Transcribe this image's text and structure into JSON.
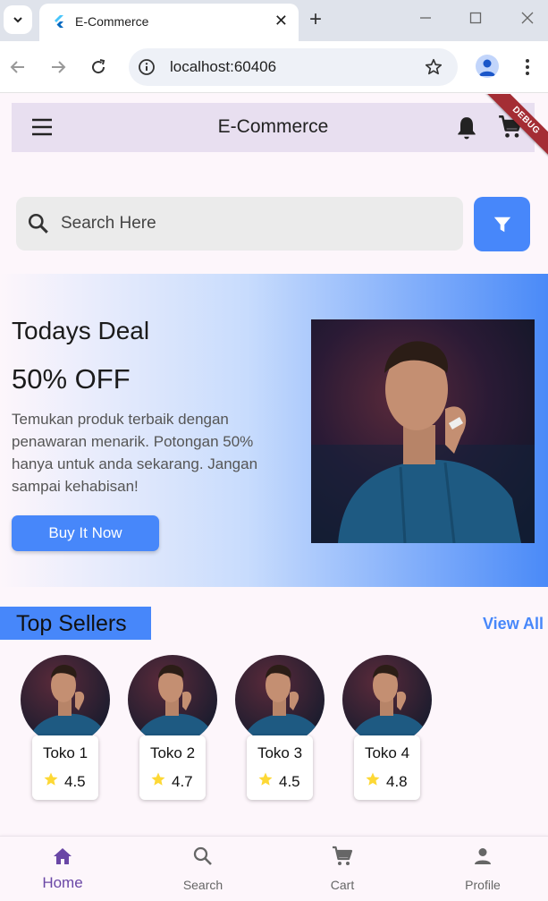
{
  "browser": {
    "tab_title": "E-Commerce",
    "url": "localhost:60406"
  },
  "app": {
    "title": "E-Commerce",
    "debug_label": "DEBUG",
    "search": {
      "placeholder": "Search Here"
    },
    "deal": {
      "title": "Todays Deal",
      "discount": "50% OFF",
      "description": "Temukan produk terbaik dengan penawaran menarik. Potongan 50% hanya untuk anda sekarang. Jangan sampai kehabisan!",
      "button": "Buy It Now"
    },
    "top_sellers": {
      "title": "Top Sellers",
      "view_all": "View All",
      "items": [
        {
          "name": "Toko 1",
          "rating": "4.5"
        },
        {
          "name": "Toko 2",
          "rating": "4.7"
        },
        {
          "name": "Toko 3",
          "rating": "4.5"
        },
        {
          "name": "Toko 4",
          "rating": "4.8"
        }
      ]
    },
    "bottom_nav": [
      {
        "label": "Home",
        "icon": "home-icon",
        "active": true
      },
      {
        "label": "Search",
        "icon": "search-icon",
        "active": false
      },
      {
        "label": "Cart",
        "icon": "cart-icon",
        "active": false
      },
      {
        "label": "Profile",
        "icon": "person-icon",
        "active": false
      }
    ]
  },
  "colors": {
    "accent": "#4787fa",
    "appbar": "#e8dff0",
    "active_nav": "#6a47a6",
    "debug": "#a42d34",
    "star": "#fdd835"
  }
}
